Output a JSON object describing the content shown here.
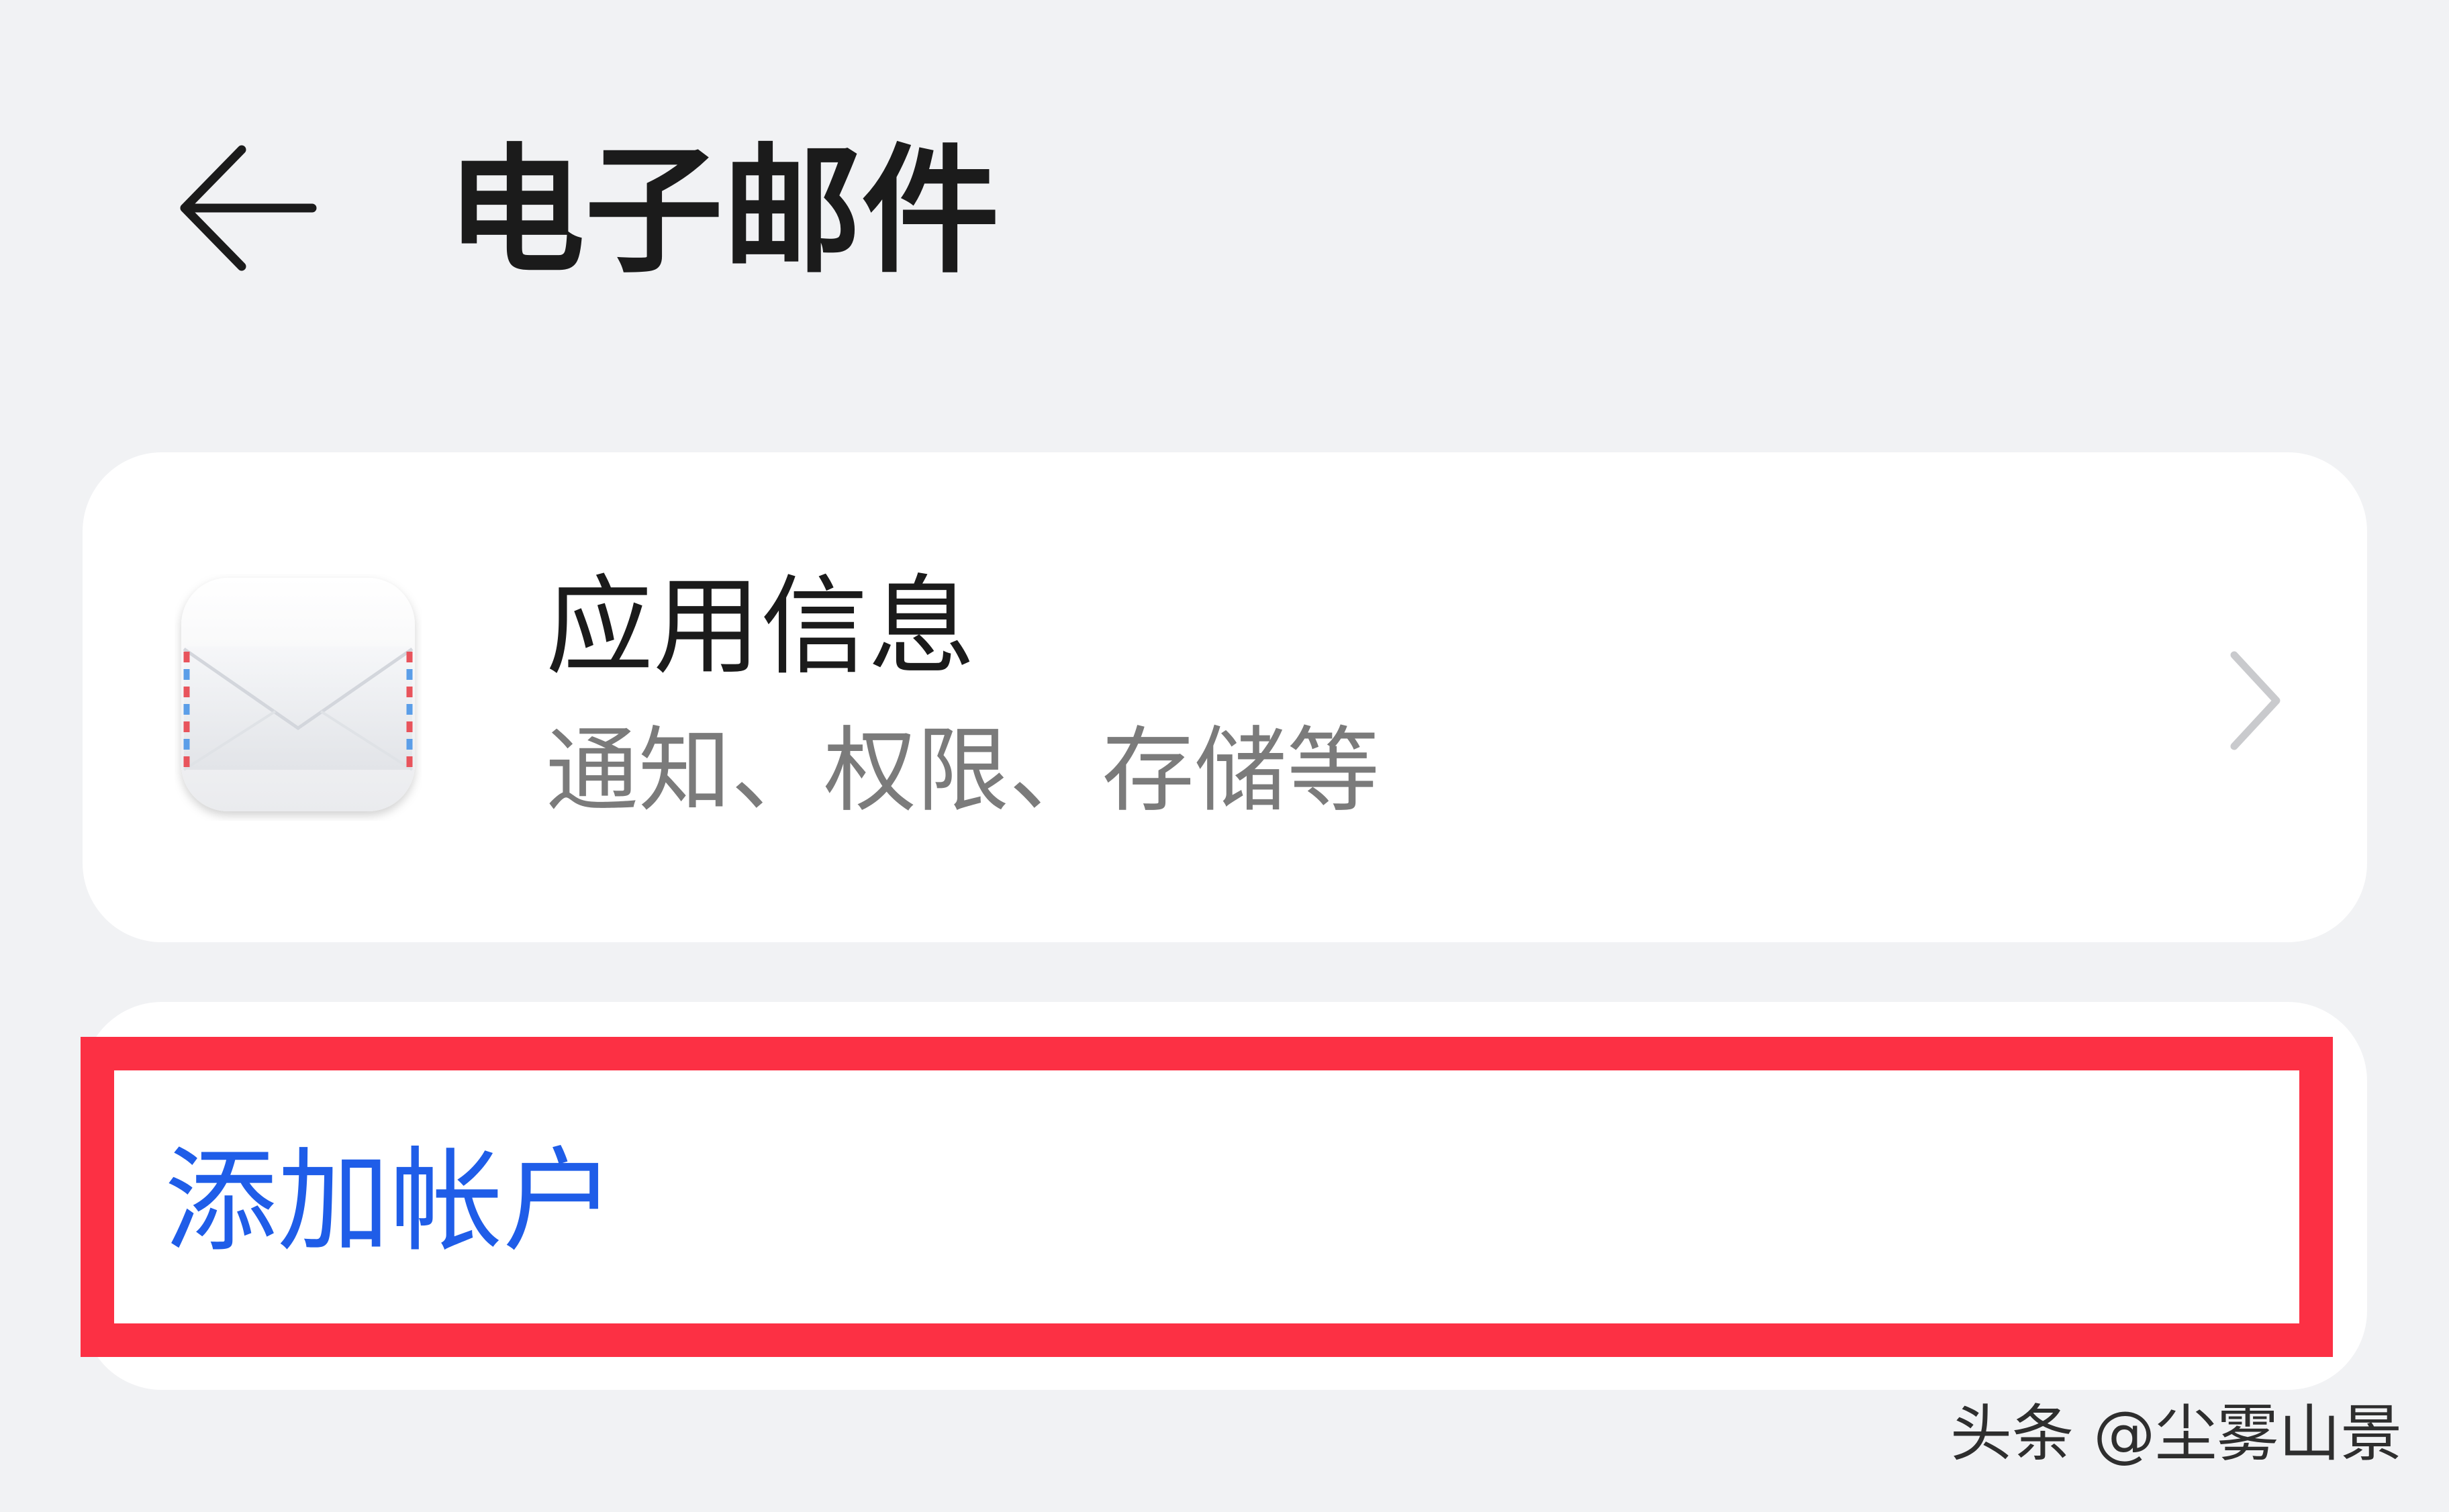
{
  "header": {
    "back_icon": "arrow-left-icon",
    "title": "电子邮件"
  },
  "app_info": {
    "icon": "mail-envelope-icon",
    "title": "应用信息",
    "subtitle": "通知、权限、存储等",
    "chevron_icon": "chevron-right-icon"
  },
  "account": {
    "add_label": "添加帐户",
    "highlight_color": "#fc3044"
  },
  "watermark": {
    "text": "头条 @尘雾山景"
  },
  "colors": {
    "background": "#f1f2f4",
    "card": "#ffffff",
    "accent": "#1f5de8",
    "primary_text": "#1b1b1b",
    "secondary_text": "#7b7b7b"
  }
}
